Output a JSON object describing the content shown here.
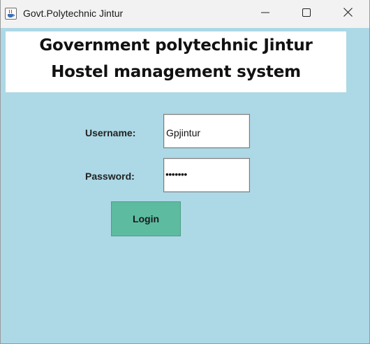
{
  "window": {
    "title": "Govt.Polytechnic Jintur",
    "app_icon": "java-coffee-icon",
    "controls": {
      "minimize_icon": "minimize-icon",
      "maximize_icon": "maximize-icon",
      "close_icon": "close-icon"
    }
  },
  "banner": {
    "line1": "Government polytechnic Jintur",
    "line2": "Hostel management system"
  },
  "form": {
    "username_label": "Username:",
    "username_value": "Gpjintur",
    "password_label": "Password:",
    "password_display": "•••••••",
    "login_label": "Login"
  },
  "colors": {
    "background": "#add8e6",
    "button": "#5dbba0",
    "titlebar": "#f2f2f2"
  }
}
